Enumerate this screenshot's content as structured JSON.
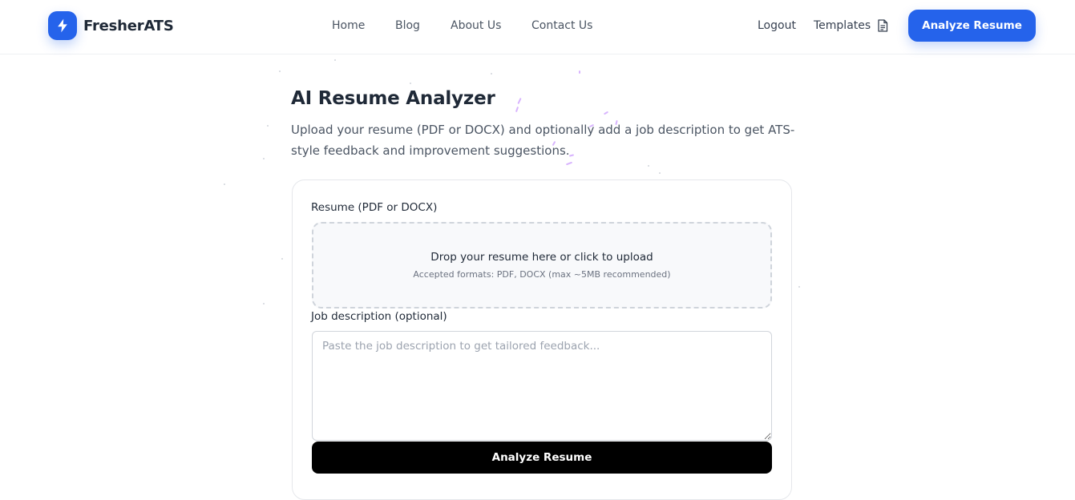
{
  "header": {
    "brand": "FresherATS",
    "nav": [
      "Home",
      "Blog",
      "About Us",
      "Contact Us"
    ],
    "logout": "Logout",
    "templates": "Templates",
    "cta": "Analyze Resume"
  },
  "main": {
    "title": "AI Resume Analyzer",
    "subtitle": "Upload your resume (PDF or DOCX) and optionally add a job description to get ATS-style feedback and improvement suggestions."
  },
  "form": {
    "resume_label": "Resume (PDF or DOCX)",
    "dropzone_text": "Drop your resume here or click to upload",
    "dropzone_hint": "Accepted formats: PDF, DOCX (max ~5MB recommended)",
    "jd_label": "Job description (optional)",
    "jd_placeholder": "Paste the job description to get tailored feedback...",
    "jd_value": "",
    "submit": "Analyze Resume"
  },
  "colors": {
    "primary": "#2563eb",
    "submit_bg": "#000000"
  },
  "icons": {
    "brand": "lightning-bolt-icon",
    "templates": "document-icon"
  }
}
